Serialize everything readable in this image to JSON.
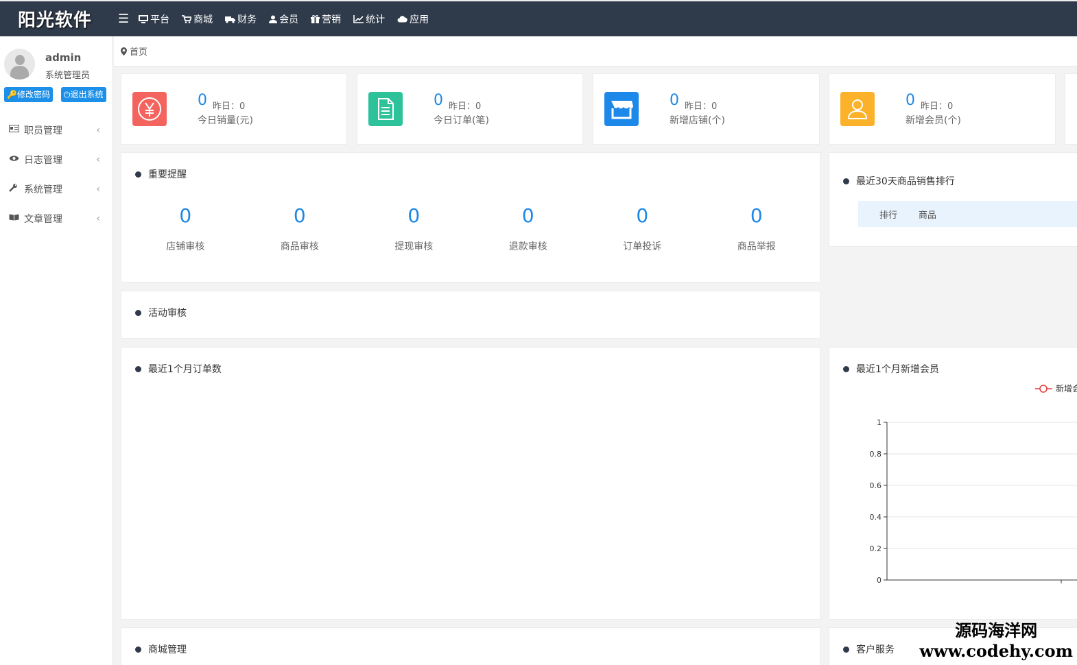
{
  "app": {
    "logo": "阳光软件",
    "nav": [
      {
        "icon": "monitor-icon",
        "label": "平台"
      },
      {
        "icon": "cart-icon",
        "label": "商城"
      },
      {
        "icon": "truck-icon",
        "label": "财务"
      },
      {
        "icon": "user-icon",
        "label": "会员"
      },
      {
        "icon": "gift-icon",
        "label": "营销"
      },
      {
        "icon": "line-chart-icon",
        "label": "统计"
      },
      {
        "icon": "cloud-icon",
        "label": "应用"
      }
    ]
  },
  "user": {
    "name": "admin",
    "role": "系统管理员",
    "change_pwd": "修改密码",
    "logout": "退出系统"
  },
  "sidebar": {
    "items": [
      {
        "icon": "id-card-icon",
        "label": "职员管理"
      },
      {
        "icon": "eye-icon",
        "label": "日志管理"
      },
      {
        "icon": "wrench-icon",
        "label": "系统管理"
      },
      {
        "icon": "book-icon",
        "label": "文章管理"
      }
    ]
  },
  "breadcrumb": {
    "label": "首页"
  },
  "stats": [
    {
      "value": "0",
      "yesterday": "昨日：0",
      "label": "今日销量(元)",
      "color": "#f4645f",
      "icon": "yen-icon"
    },
    {
      "value": "0",
      "yesterday": "昨日：0",
      "label": "今日订单(笔)",
      "color": "#2ec29b",
      "icon": "document-icon"
    },
    {
      "value": "0",
      "yesterday": "昨日：0",
      "label": "新增店铺(个)",
      "color": "#1c88e9",
      "icon": "store-icon"
    },
    {
      "value": "0",
      "yesterday": "昨日：0",
      "label": "新增会员(个)",
      "color": "#fbb22a",
      "icon": "member-icon"
    }
  ],
  "panels": {
    "reminder": {
      "title": "重要提醒",
      "items": [
        {
          "value": "0",
          "label": "店铺审核"
        },
        {
          "value": "0",
          "label": "商品审核"
        },
        {
          "value": "0",
          "label": "提现审核"
        },
        {
          "value": "0",
          "label": "退款审核"
        },
        {
          "value": "0",
          "label": "订单投诉"
        },
        {
          "value": "0",
          "label": "商品举报"
        }
      ]
    },
    "ranking": {
      "title": "最近30天商品销售排行",
      "col_rank": "排行",
      "col_goods": "商品"
    },
    "activity": {
      "title": "活动审核"
    },
    "orders": {
      "title": "最近1个月订单数"
    },
    "members": {
      "title": "最近1个月新增会员",
      "legend": "新增会"
    },
    "mall": {
      "title": "商城管理"
    },
    "service": {
      "title": "客户服务"
    }
  },
  "chart_data": {
    "type": "line",
    "title": "",
    "series": [
      {
        "name": "新增会",
        "values": []
      }
    ],
    "ylim": [
      0,
      1
    ],
    "yticks": [
      "0",
      "0.2",
      "0.4",
      "0.6",
      "0.8",
      "1"
    ],
    "grid": true,
    "legend": "top-right"
  },
  "watermark": {
    "line1": "源码海洋网",
    "line2": "www.codehy.com"
  }
}
